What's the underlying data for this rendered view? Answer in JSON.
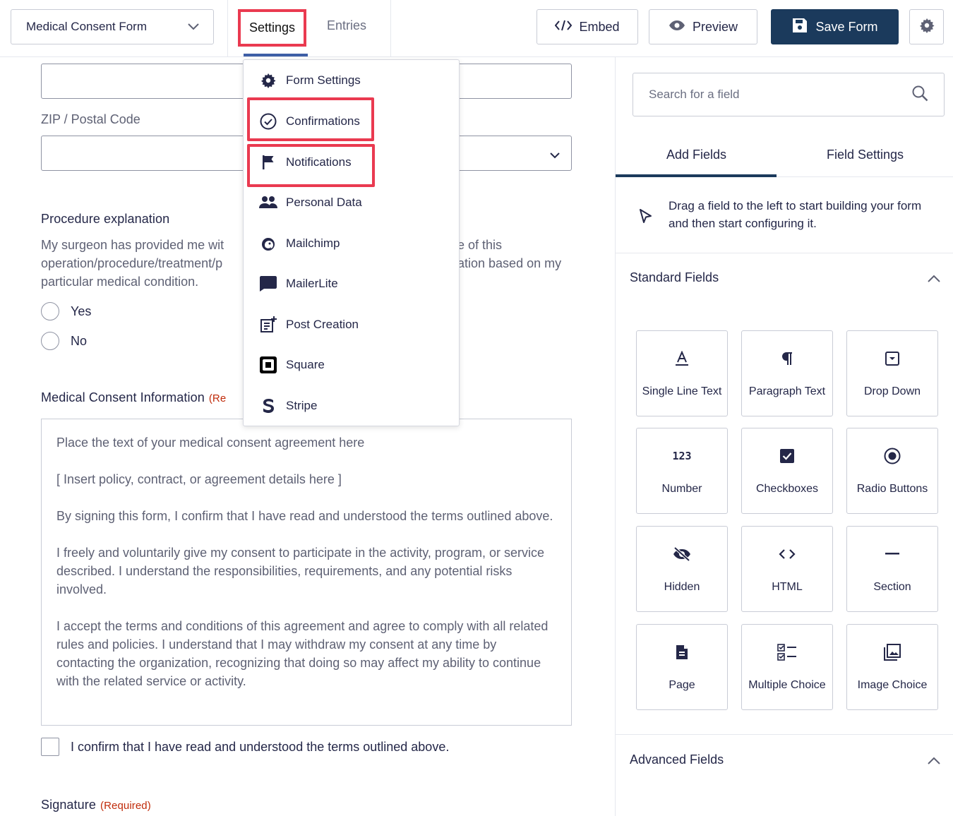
{
  "topbar": {
    "form_name": "Medical Consent Form",
    "tabs": [
      {
        "label": "Settings",
        "active": true
      },
      {
        "label": "Entries",
        "active": false
      }
    ],
    "embed_label": "Embed",
    "preview_label": "Preview",
    "save_label": "Save Form"
  },
  "settings_menu": {
    "items": [
      {
        "label": "Form Settings",
        "icon": "gear-icon"
      },
      {
        "label": "Confirmations",
        "icon": "check-circle-icon",
        "highlighted": true
      },
      {
        "label": "Notifications",
        "icon": "flag-icon",
        "highlighted": true
      },
      {
        "label": "Personal Data",
        "icon": "users-icon"
      },
      {
        "label": "Mailchimp",
        "icon": "mailchimp-icon"
      },
      {
        "label": "MailerLite",
        "icon": "chat-bubble-icon"
      },
      {
        "label": "Post Creation",
        "icon": "post-add-icon"
      },
      {
        "label": "Square",
        "icon": "square-logo-icon"
      },
      {
        "label": "Stripe",
        "icon": "stripe-logo-icon"
      }
    ]
  },
  "form": {
    "zip_label": "ZIP / Postal Code",
    "procedure": {
      "label": "Procedure explanation",
      "text_left": "My surgeon has provided me wit",
      "text_right_1": "e of this",
      "text_line2_left": "operation/procedure/treatment/p",
      "text_line2_right": "ation based on my",
      "text_line3": "particular medical condition.",
      "options": [
        "Yes",
        "No"
      ]
    },
    "consent": {
      "label": "Medical Consent Information",
      "required_partial": "(Re",
      "paragraphs": [
        "Place the text of your medical consent agreement here",
        "[ Insert policy, contract, or agreement details here ]",
        "By signing this form, I confirm that I have read and understood the terms outlined above.",
        "I freely and voluntarily give my consent to participate in the activity, program, or service described. I understand the responsibilities, requirements, and any potential risks involved.",
        "I accept the terms and conditions of this agreement and agree to comply with all related rules and policies. I understand that I may withdraw my consent at any time by contacting the organization, recognizing that doing so may affect my ability to continue with the related service or activity."
      ],
      "checkbox_label": "I confirm that I have read and understood the terms outlined above."
    },
    "signature": {
      "label": "Signature",
      "required": "(Required)"
    }
  },
  "panel": {
    "search_placeholder": "Search for a field",
    "tabs": [
      "Add Fields",
      "Field Settings"
    ],
    "hint": "Drag a field to the left to start building your form and then start configuring it.",
    "standard_title": "Standard Fields",
    "advanced_title": "Advanced Fields",
    "standard_fields": [
      {
        "label": "Single Line Text",
        "icon": "single-line-text-icon"
      },
      {
        "label": "Paragraph Text",
        "icon": "paragraph-icon"
      },
      {
        "label": "Drop Down",
        "icon": "dropdown-icon"
      },
      {
        "label": "Number",
        "icon": "number-icon",
        "glyph": "123"
      },
      {
        "label": "Checkboxes",
        "icon": "checkbox-icon"
      },
      {
        "label": "Radio Buttons",
        "icon": "radio-icon"
      },
      {
        "label": "Hidden",
        "icon": "eye-slash-icon"
      },
      {
        "label": "HTML",
        "icon": "code-icon"
      },
      {
        "label": "Section",
        "icon": "minus-icon"
      },
      {
        "label": "Page",
        "icon": "document-icon"
      },
      {
        "label": "Multiple Choice",
        "icon": "checklist-icon"
      },
      {
        "label": "Image Choice",
        "icon": "images-icon"
      }
    ]
  },
  "colors": {
    "accent": "#1b3a5c",
    "highlight": "#ea3a50",
    "required": "#c02b0a"
  }
}
